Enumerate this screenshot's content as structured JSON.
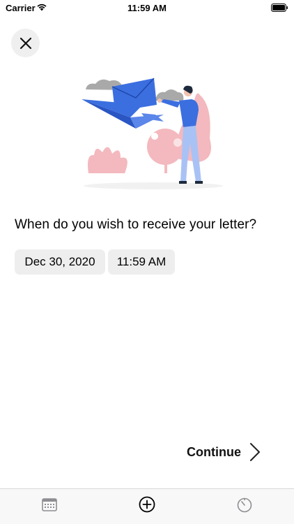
{
  "status_bar": {
    "carrier": "Carrier",
    "time": "11:59 AM"
  },
  "header": {
    "close_icon": "close-icon"
  },
  "content": {
    "question": "When do you wish to receive your letter?",
    "date_value": "Dec 30, 2020",
    "time_value": "11:59 AM"
  },
  "footer": {
    "continue_label": "Continue"
  },
  "tab_bar": {
    "tabs": [
      {
        "icon": "calendar-icon"
      },
      {
        "icon": "add-circle-icon"
      },
      {
        "icon": "timer-icon"
      }
    ]
  },
  "colors": {
    "accent_blue": "#3b6fe0",
    "pink": "#f2b8bd",
    "pill_bg": "#eeeeef"
  }
}
